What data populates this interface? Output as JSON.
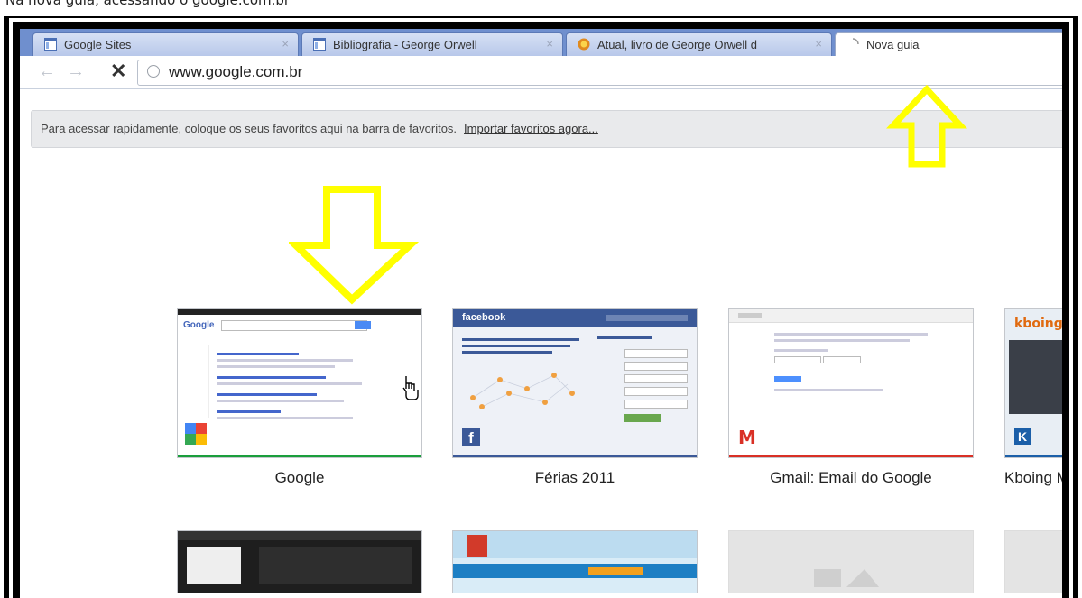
{
  "caption": "Na nova guia, acessando o google.com.br",
  "tabs": [
    {
      "label": "Google Sites",
      "icon": "google-sites-icon"
    },
    {
      "label": "Bibliografia - George Orwell",
      "icon": "google-sites-icon"
    },
    {
      "label": "Atual, livro de George Orwell d",
      "icon": "book-site-icon"
    },
    {
      "label": "Nova guia",
      "icon": "loading-spinner-icon"
    }
  ],
  "tab_close_glyph": "×",
  "toolbar": {
    "back_glyph": "←",
    "forward_glyph": "→",
    "stop_glyph": "✕",
    "url": "www.google.com.br"
  },
  "bookmarks_bar": {
    "message": "Para acessar rapidamente, coloque os seus favoritos aqui na barra de favoritos.",
    "import_link": "Importar favoritos agora..."
  },
  "most_visited": [
    {
      "title": "Google",
      "thumb": "google-search-page"
    },
    {
      "title": "Férias 2011",
      "thumb": "facebook-page"
    },
    {
      "title": "Gmail: Email do Google",
      "thumb": "gmail-page"
    },
    {
      "title": "Kboing M",
      "thumb": "kboing-page"
    }
  ],
  "thumb_texts": {
    "facebook": "facebook",
    "facebook_f": "f",
    "gmail_m": "M",
    "kboing": "kboing",
    "kboing_k": "K",
    "google_logo": "Google"
  },
  "colors": {
    "tabstrip": "#6f8fce",
    "arrow": "#ffff00",
    "facebook_blue": "#3b5998",
    "gmail_red": "#d93025"
  }
}
